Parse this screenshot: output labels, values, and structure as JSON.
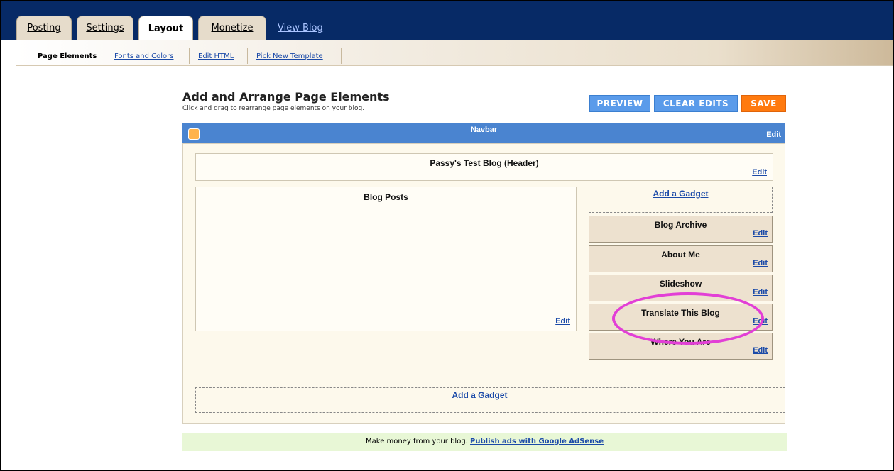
{
  "tabs": {
    "posting": "Posting",
    "settings": "Settings",
    "layout": "Layout",
    "monetize": "Monetize",
    "view_blog": "View Blog"
  },
  "subtabs": {
    "page_elements": "Page Elements",
    "fonts_colors": "Fonts and Colors",
    "edit_html": "Edit HTML",
    "pick_template": "Pick New Template"
  },
  "heading": {
    "title": "Add and Arrange Page Elements",
    "subtitle": "Click and drag to rearrange page elements on your blog."
  },
  "buttons": {
    "preview": "PREVIEW",
    "clear_edits": "CLEAR EDITS",
    "save": "SAVE"
  },
  "navbar": {
    "title": "Navbar",
    "edit": "Edit"
  },
  "header": {
    "title": "Passy's Test Blog (Header)",
    "edit": "Edit"
  },
  "posts": {
    "title": "Blog Posts",
    "edit": "Edit"
  },
  "sidebar": {
    "add_gadget": "Add a Gadget",
    "items": [
      {
        "title": "Blog Archive",
        "edit": "Edit"
      },
      {
        "title": "About Me",
        "edit": "Edit"
      },
      {
        "title": "Slideshow",
        "edit": "Edit"
      },
      {
        "title": "Translate This Blog",
        "edit": "Edit"
      },
      {
        "title": "Where You Are",
        "edit": "Edit"
      }
    ]
  },
  "footer_gadget": {
    "add_gadget": "Add a Gadget"
  },
  "adsense": {
    "text": "Make money from your blog.",
    "link": "Publish ads with Google AdSense"
  },
  "colors": {
    "topbar": "#072a66",
    "navbar": "#4a84d0",
    "button_blue": "#5a9bea",
    "button_orange": "#ff7a0f",
    "highlight": "#e23fd6"
  }
}
